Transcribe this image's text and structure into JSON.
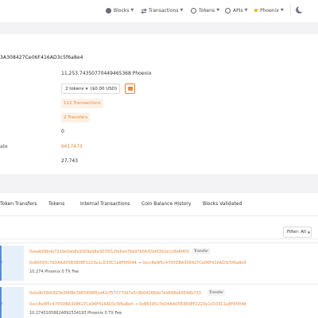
{
  "nav": {
    "blocks": "Blocks",
    "transactions": "Transactions",
    "tokens": "Tokens",
    "apis": "APIs",
    "network": "Phoenix"
  },
  "address": {
    "hash_fragment": "3A308427Ce06F416AD3c5f6a8e4",
    "balance": "11,253.74350770449465368 Phoenix",
    "tokens_select": "2 tokens",
    "tokens_value": "($0.00 USD)",
    "transactions": "112 Transactions",
    "transfers": "2 Transfers",
    "gas_used": "0",
    "last_balance_update_label_fragment": "ate",
    "last_balance_update": "6617473",
    "validated": "27,743"
  },
  "tabs": [
    "Token Transfers",
    "Tokens",
    "Internal Transactions",
    "Coin Balance History",
    "Blocks Validated"
  ],
  "filter": {
    "label": "Filter: All"
  },
  "transfers": [
    {
      "side": "n",
      "hash": "0xeab96bde7219e0ab8a9309ab6e3076f12fe6ee78a97b5642bfd392e1c8e8f4f3",
      "badge": "Transfer",
      "from": "0xB6595c7bD4AA05B3808F2223e1cD33C1a8F6f0f44",
      "arrow": "→",
      "to": "0xcc8e9f5c4705DBA308427Ce06F416AD3c5f6a8e4",
      "amount": "10.274 Phoenix",
      "fee": "0 TX Fee"
    },
    {
      "side": "n",
      "hash": "0xfa9b59dc823e0f4f8e3983998f6ce42cf572770d7e5c8b04188eb7eb648e69544b733",
      "badge": "Transfer",
      "from": "0xcc8e9f5c4705DBA308427Ce06F416AD3c5f6a8e4",
      "arrow": "→",
      "to": "0xB6595c7bD4AA05B3808F2223e1cD33C1a8F6f0f44",
      "amount": "10.27401058624892534193 Phoenix",
      "fee": "0 TX Fee"
    }
  ]
}
